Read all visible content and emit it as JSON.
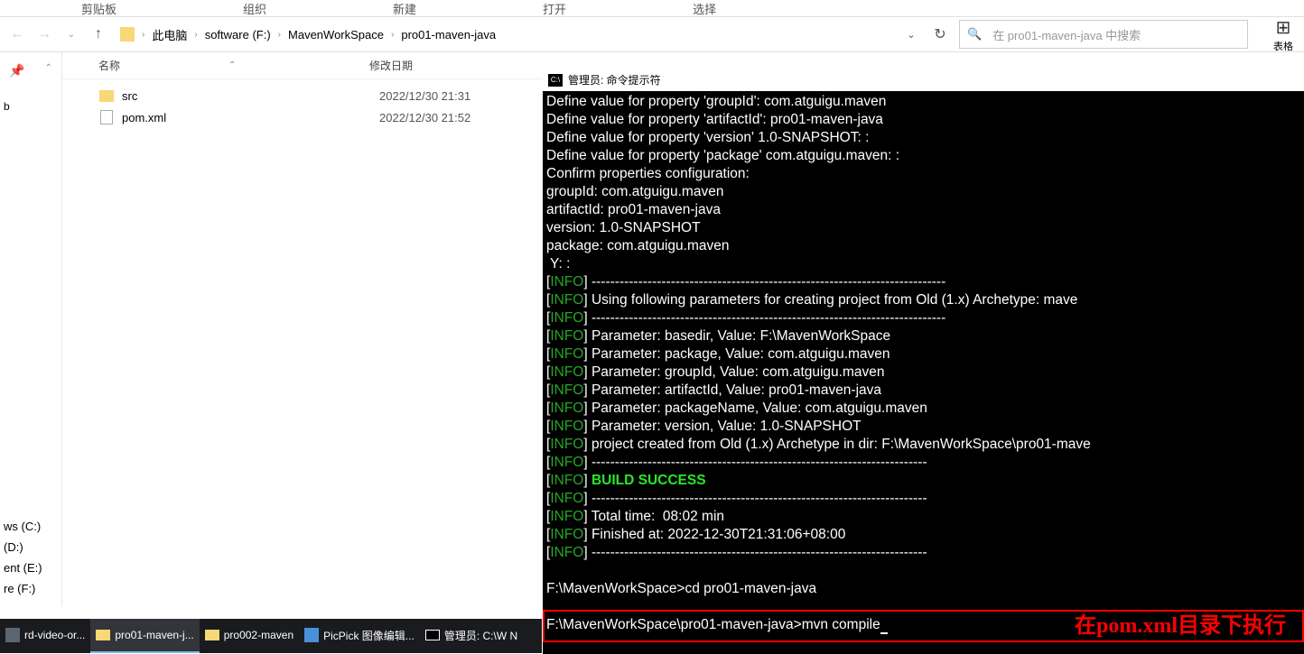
{
  "ribbon": {
    "tabs": [
      "剪贴板",
      "组织",
      "新建",
      "打开",
      "选择"
    ]
  },
  "breadcrumbs": {
    "items": [
      "此电脑",
      "software (F:)",
      "MavenWorkSpace",
      "pro01-maven-java"
    ]
  },
  "search": {
    "placeholder": "在 pro01-maven-java 中搜索"
  },
  "right_panel": {
    "label": "表格"
  },
  "columns": {
    "name": "名称",
    "modified": "修改日期"
  },
  "files": [
    {
      "name": "src",
      "type": "folder",
      "modified": "2022/12/30 21:31"
    },
    {
      "name": "pom.xml",
      "type": "file",
      "modified": "2022/12/30 21:52"
    }
  ],
  "sidebar_top": {
    "item": "b"
  },
  "drives": [
    "ws (C:)",
    "(D:)",
    "ent (E:)",
    "re (F:)"
  ],
  "terminal": {
    "title": "管理员: 命令提示符",
    "lines": [
      "Define value for property 'groupId': com.atguigu.maven",
      "Define value for property 'artifactId': pro01-maven-java",
      "Define value for property 'version' 1.0-SNAPSHOT: :",
      "Define value for property 'package' com.atguigu.maven: :",
      "Confirm properties configuration:",
      "groupId: com.atguigu.maven",
      "artifactId: pro01-maven-java",
      "version: 1.0-SNAPSHOT",
      "package: com.atguigu.maven",
      " Y: :"
    ],
    "info_lines": [
      "----------------------------------------------------------------------------",
      "Using following parameters for creating project from Old (1.x) Archetype: mave",
      "----------------------------------------------------------------------------",
      "Parameter: basedir, Value: F:\\MavenWorkSpace",
      "Parameter: package, Value: com.atguigu.maven",
      "Parameter: groupId, Value: com.atguigu.maven",
      "Parameter: artifactId, Value: pro01-maven-java",
      "Parameter: packageName, Value: com.atguigu.maven",
      "Parameter: version, Value: 1.0-SNAPSHOT",
      "project created from Old (1.x) Archetype in dir: F:\\MavenWorkSpace\\pro01-mave",
      "------------------------------------------------------------------------"
    ],
    "build": "BUILD SUCCESS",
    "info_lines2": [
      "------------------------------------------------------------------------",
      "Total time:  08:02 min",
      "Finished at: 2022-12-30T21:31:06+08:00",
      "------------------------------------------------------------------------"
    ],
    "prompt1": "F:\\MavenWorkSpace>cd pro01-maven-java",
    "prompt2": "F:\\MavenWorkSpace\\pro01-maven-java>mvn compile"
  },
  "annotation": "在pom.xml目录下执行",
  "taskbar": [
    {
      "label": "rd-video-or...",
      "icon": "generic"
    },
    {
      "label": "pro01-maven-j...",
      "icon": "folder"
    },
    {
      "label": "pro002-maven",
      "icon": "folder"
    },
    {
      "label": "PicPick 图像编辑...",
      "icon": "picpick"
    },
    {
      "label": "管理员: C:\\W N",
      "icon": "cmd"
    }
  ],
  "info_label": "INFO"
}
